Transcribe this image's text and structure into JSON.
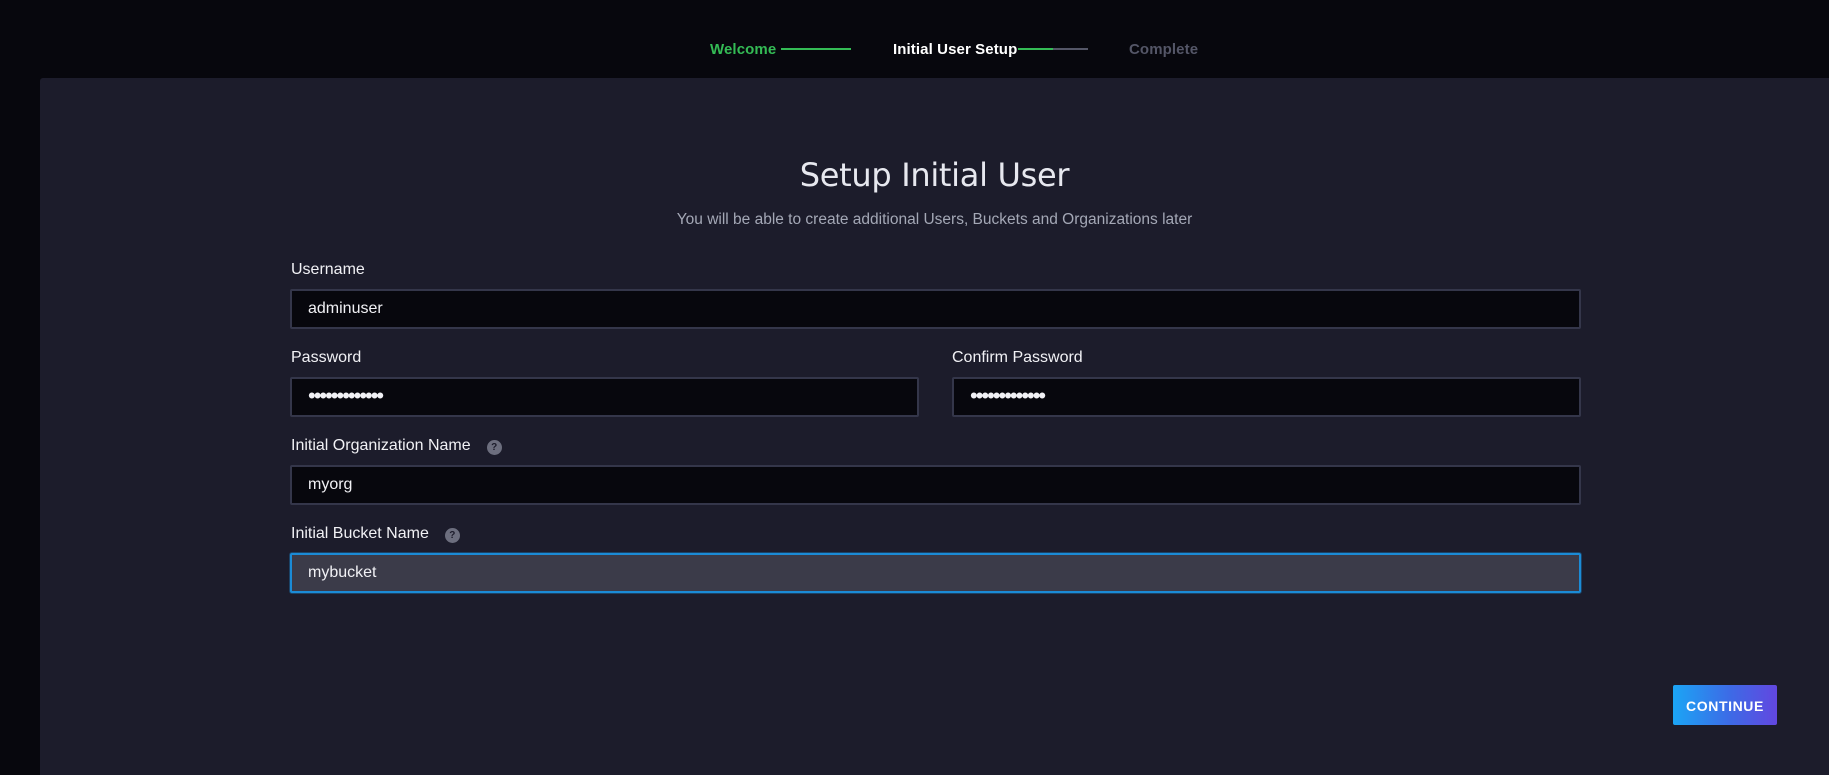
{
  "stepper": {
    "steps": [
      {
        "label": "Welcome",
        "state": "done"
      },
      {
        "label": "Initial User Setup",
        "state": "active"
      },
      {
        "label": "Complete",
        "state": "pending"
      }
    ],
    "current_step_progress": 0.5
  },
  "form": {
    "title": "Setup Initial User",
    "subtitle": "You will be able to create additional Users, Buckets and Organizations later",
    "username": {
      "label": "Username",
      "value": "adminuser"
    },
    "password": {
      "label": "Password",
      "value": "•••••••••••••"
    },
    "confirm_password": {
      "label": "Confirm Password",
      "value": "•••••••••••••"
    },
    "org_name": {
      "label": "Initial Organization Name",
      "value": "myorg",
      "help_icon": "question-circle-icon"
    },
    "bucket_name": {
      "label": "Initial Bucket Name",
      "value": "mybucket",
      "help_icon": "question-circle-icon",
      "focused": true
    }
  },
  "actions": {
    "continue_label": "CONTINUE"
  },
  "colors": {
    "success": "#34bb55",
    "focus": "#1b8bd6",
    "panel": "#1c1c2b",
    "background": "#07070d"
  }
}
